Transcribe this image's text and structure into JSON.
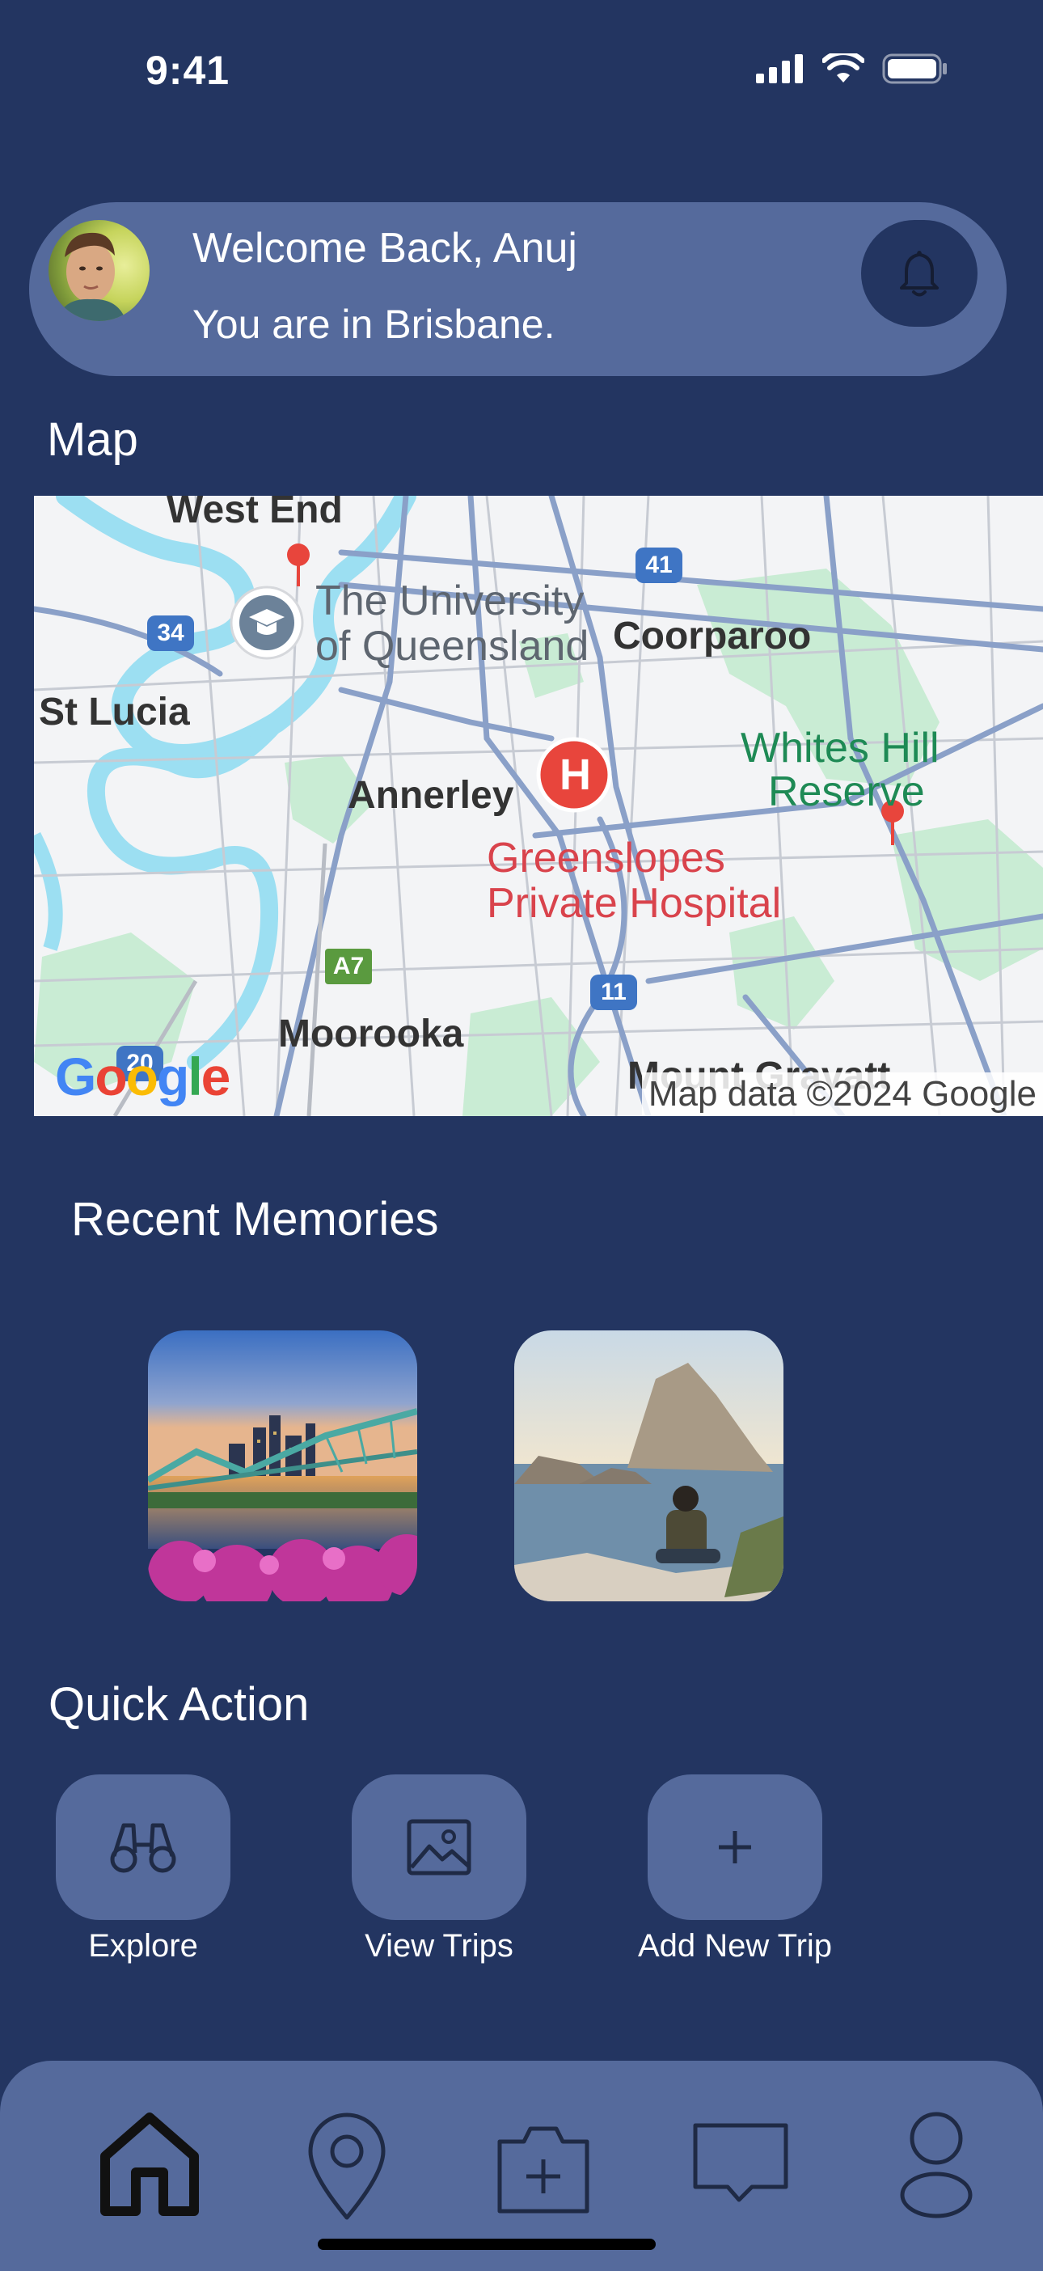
{
  "status_bar": {
    "time": "9:41"
  },
  "header": {
    "greeting": "Welcome Back, Anuj",
    "location_text": "You are in Brisbane.",
    "avatar_alt": "user-avatar"
  },
  "map_section": {
    "title": "Map",
    "labels": {
      "west_end": "West End",
      "uq_line1": "The University",
      "uq_line2": "of Queensland",
      "coorparoo": "Coorparoo",
      "st_lucia": "St Lucia",
      "whites_line1": "Whites Hill",
      "whites_line2": "Reserve",
      "annerley": "Annerley",
      "hospital_line1": "Greenslopes",
      "hospital_line2": "Private Hospital",
      "moorooka": "Moorooka",
      "mount_gravatt": "Mount Gravatt",
      "hospital_marker": "H"
    },
    "road_shields": [
      "34",
      "41",
      "A7",
      "11",
      "20"
    ],
    "attribution": "Map data ©2024 Google",
    "logo_text": "Google"
  },
  "memories": {
    "title": "Recent Memories",
    "items": [
      {
        "name": "memory-brisbane-bridge"
      },
      {
        "name": "memory-coastal-rock"
      }
    ]
  },
  "quick_action": {
    "title": "Quick Action",
    "actions": [
      {
        "label": "Explore",
        "icon": "binoculars-icon"
      },
      {
        "label": "View Trips",
        "icon": "image-icon"
      },
      {
        "label": "Add New Trip",
        "icon": "plus-icon"
      }
    ]
  },
  "bottom_nav": {
    "items": [
      {
        "icon": "home-icon",
        "active": true
      },
      {
        "icon": "location-pin-icon",
        "active": false
      },
      {
        "icon": "camera-add-icon",
        "active": false
      },
      {
        "icon": "chat-icon",
        "active": false
      },
      {
        "icon": "profile-icon",
        "active": false
      }
    ]
  },
  "colors": {
    "background": "#233561",
    "card": "#556a9c",
    "icon_dark": "#1f2a45"
  }
}
